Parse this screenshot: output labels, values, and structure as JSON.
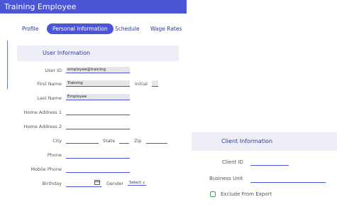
{
  "window": {
    "title": "Training Employee"
  },
  "tabs": [
    {
      "label": "Profile"
    },
    {
      "label": "Personal Information",
      "active": true
    },
    {
      "label": "Schedule"
    },
    {
      "label": "Wage Rates"
    }
  ],
  "user_info": {
    "heading": "User Information",
    "user_id": {
      "label": "User ID",
      "value": "employee@training"
    },
    "first_name": {
      "label": "First Name",
      "value": "Training"
    },
    "initial": {
      "label": "Initial",
      "value": ""
    },
    "last_name": {
      "label": "Last Name",
      "value": "Employee"
    },
    "home_address_1": {
      "label": "Home Address 1",
      "value": ""
    },
    "home_address_2": {
      "label": "Home Address 2",
      "value": ""
    },
    "city": {
      "label": "City",
      "value": ""
    },
    "state": {
      "label": "State",
      "value": ""
    },
    "zip": {
      "label": "Zip",
      "value": ""
    },
    "phone": {
      "label": "Phone",
      "value": ""
    },
    "mobile_phone": {
      "label": "Mobile Phone",
      "value": ""
    },
    "birthday": {
      "label": "Birthday",
      "value": ""
    },
    "gender": {
      "label": "Gender",
      "value": "Select",
      "icon": "chevron-down-icon"
    }
  },
  "client_info": {
    "heading": "Client Information",
    "client_id": {
      "label": "Client ID",
      "value": ""
    },
    "business_unit": {
      "label": "Business Unit",
      "value": ""
    },
    "exclude_from_export": {
      "label": "Exclude From Export",
      "checked": false
    }
  },
  "colors": {
    "accent": "#4a56d6",
    "panel_bg": "#eeeff6",
    "checkbox": "#3ea55e"
  }
}
